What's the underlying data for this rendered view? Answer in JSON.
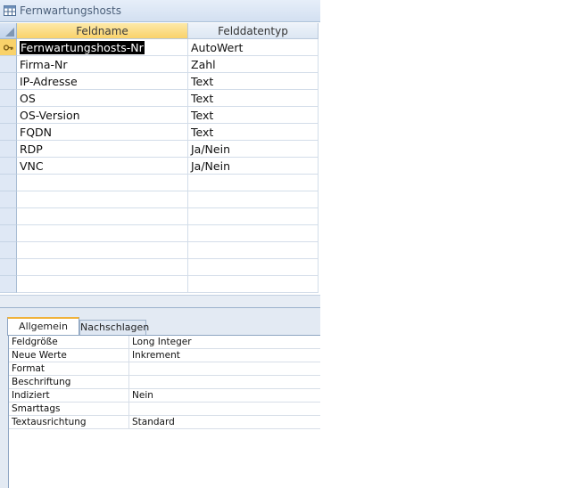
{
  "window": {
    "title": "Fernwartungshosts",
    "icon": "table-icon"
  },
  "grid": {
    "columns": [
      "Feldname",
      "Felddatentyp"
    ],
    "rows": [
      {
        "name": "Fernwartungshosts-Nr",
        "type": "AutoWert",
        "primary_key": true,
        "selected": true
      },
      {
        "name": "Firma-Nr",
        "type": "Zahl"
      },
      {
        "name": "IP-Adresse",
        "type": "Text"
      },
      {
        "name": "OS",
        "type": "Text"
      },
      {
        "name": "OS-Version",
        "type": "Text"
      },
      {
        "name": "FQDN",
        "type": "Text"
      },
      {
        "name": "RDP",
        "type": "Ja/Nein"
      },
      {
        "name": "VNC",
        "type": "Ja/Nein"
      },
      {
        "name": "",
        "type": ""
      },
      {
        "name": "",
        "type": ""
      },
      {
        "name": "",
        "type": ""
      },
      {
        "name": "",
        "type": ""
      },
      {
        "name": "",
        "type": ""
      },
      {
        "name": "",
        "type": ""
      },
      {
        "name": "",
        "type": ""
      }
    ]
  },
  "property_tabs": [
    {
      "label": "Allgemein",
      "active": true
    },
    {
      "label": "Nachschlagen",
      "active": false
    }
  ],
  "properties": [
    {
      "label": "Feldgröße",
      "value": "Long Integer"
    },
    {
      "label": "Neue Werte",
      "value": "Inkrement"
    },
    {
      "label": "Format",
      "value": ""
    },
    {
      "label": "Beschriftung",
      "value": ""
    },
    {
      "label": "Indiziert",
      "value": "Nein"
    },
    {
      "label": "Smarttags",
      "value": ""
    },
    {
      "label": "Textausrichtung",
      "value": "Standard"
    }
  ],
  "colors": {
    "active_header": "#f9d26a",
    "selection": "#000000",
    "panel": "#e3eaf3"
  }
}
